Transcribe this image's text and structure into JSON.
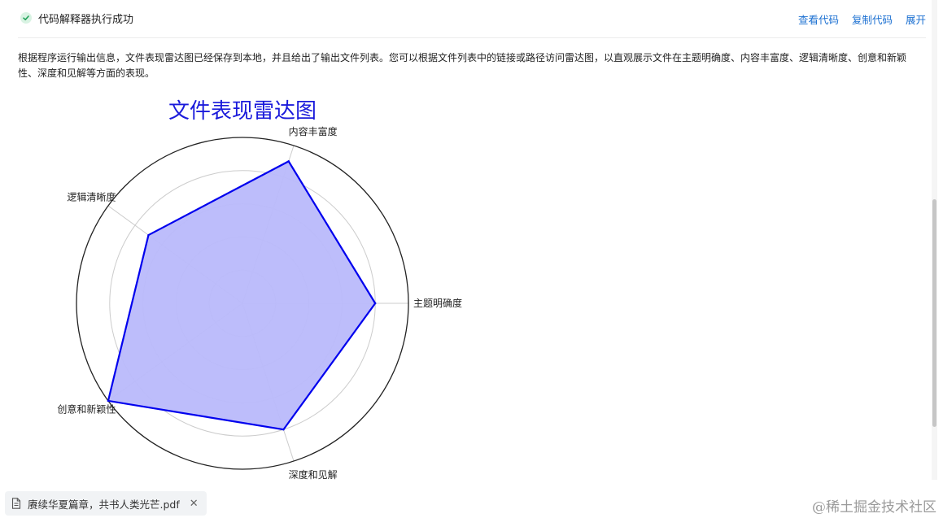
{
  "header": {
    "status_text": "代码解释器执行成功",
    "actions": [
      "查看代码",
      "复制代码",
      "展开"
    ]
  },
  "description": "根据程序运行输出信息，文件表现雷达图已经保存到本地，并且给出了输出文件列表。您可以根据文件列表中的链接或路径访问雷达图，以直观展示文件在主题明确度、内容丰富度、逻辑清晰度、创意和新颖性、深度和见解等方面的表现。",
  "chart_data": {
    "type": "radar",
    "title": "文件表现雷达图",
    "axes": [
      "主题明确度",
      "内容丰富度",
      "逻辑清晰度",
      "创意和新颖性",
      "深度和见解"
    ],
    "values": [
      8,
      9,
      7,
      10,
      8
    ],
    "rmax": 10,
    "rings": 5,
    "colors": {
      "title": "#1a1adb",
      "line": "#0000ee",
      "fill": "#b9b9fb"
    }
  },
  "attachment": {
    "filename": "赓续华夏篇章，共书人类光芒.pdf"
  },
  "watermark": "@稀土掘金技术社区"
}
